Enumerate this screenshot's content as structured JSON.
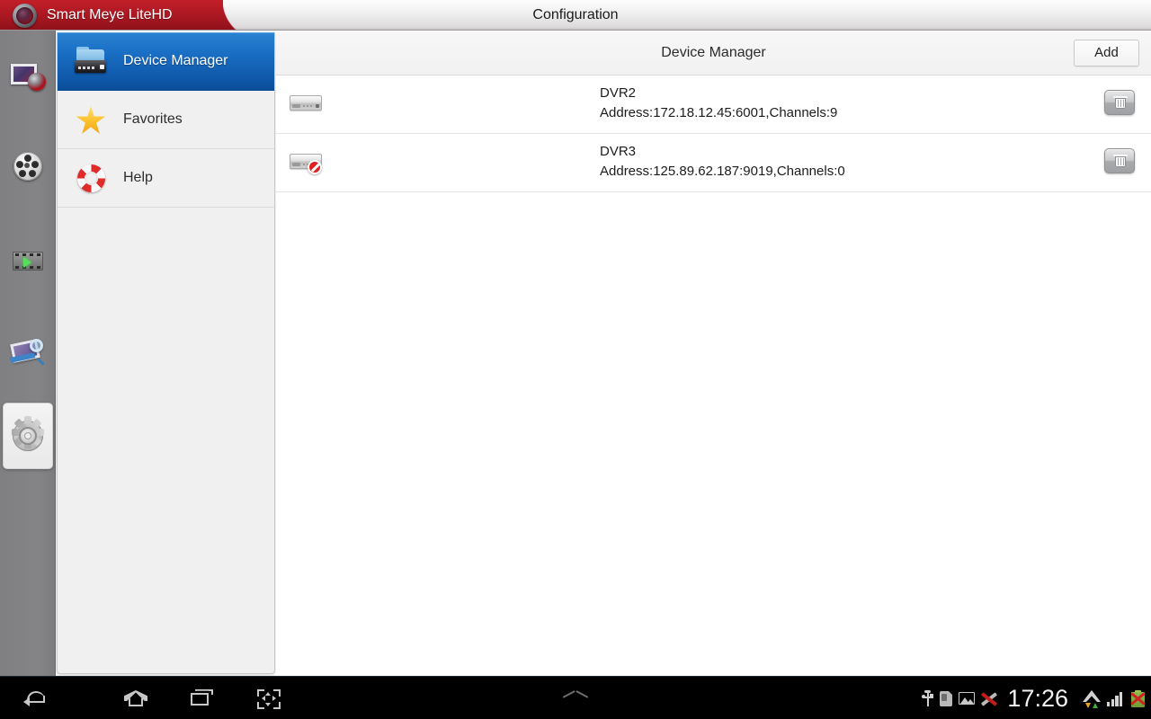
{
  "titlebar": {
    "app_name": "Smart Meye LiteHD",
    "window_title": "Configuration",
    "logo_icon": "camera-lens-icon"
  },
  "rail": {
    "items": [
      {
        "icon": "live-view-icon",
        "selected": false
      },
      {
        "icon": "film-reel-icon",
        "selected": false
      },
      {
        "icon": "video-clip-icon",
        "selected": false
      },
      {
        "icon": "image-search-icon",
        "selected": false
      },
      {
        "icon": "gear-settings-icon",
        "selected": true
      }
    ]
  },
  "sidebar": {
    "items": [
      {
        "label": "Device Manager",
        "icon": "device-folder-icon",
        "active": true
      },
      {
        "label": "Favorites",
        "icon": "star-icon",
        "active": false
      },
      {
        "label": "Help",
        "icon": "lifebuoy-icon",
        "active": false
      }
    ]
  },
  "main": {
    "header_title": "Device Manager",
    "add_label": "Add",
    "devices": [
      {
        "name": "DVR2",
        "address": "Address:172.18.12.45:6001,Channels:9",
        "status_icon": "dvr-online-icon",
        "delete_icon": "trash-icon"
      },
      {
        "name": "DVR3",
        "address": "Address:125.89.62.187:9019,Channels:0",
        "status_icon": "dvr-offline-icon",
        "delete_icon": "trash-icon"
      }
    ]
  },
  "navbar": {
    "buttons": [
      {
        "icon": "back-icon"
      },
      {
        "icon": "home-icon"
      },
      {
        "icon": "recent-apps-icon"
      },
      {
        "icon": "screenshot-icon"
      }
    ],
    "expand_icon": "chevron-up-icon"
  },
  "statusbar": {
    "clock": "17:26",
    "icons": [
      "usb-icon",
      "sim-card-icon",
      "picture-icon",
      "x-mark-icon",
      "wifi-icon",
      "signal-bars-icon",
      "battery-error-icon"
    ]
  },
  "colors": {
    "brand_red": "#ab1822",
    "accent_blue": "#1a6fc4",
    "rail_gray": "#828184",
    "panel_gray": "#f0f0f0"
  }
}
